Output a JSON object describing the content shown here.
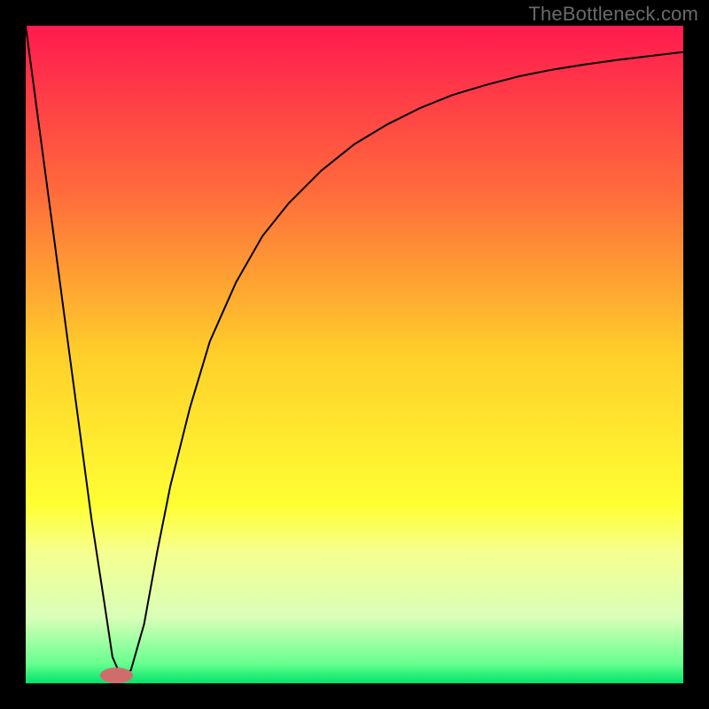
{
  "watermark": "TheBottleneck.com",
  "frame": {
    "outer_size": 800,
    "border_width": 29,
    "border_color": "#000000"
  },
  "chart_data": {
    "type": "line",
    "title": "",
    "xlabel": "",
    "ylabel": "",
    "xlim": [
      0,
      100
    ],
    "ylim": [
      0,
      100
    ],
    "gradient_stops": [
      {
        "offset": 0.0,
        "color": "#ff1a4f"
      },
      {
        "offset": 0.25,
        "color": "#ff6a3c"
      },
      {
        "offset": 0.5,
        "color": "#ffcf2a"
      },
      {
        "offset": 0.73,
        "color": "#ffff33"
      },
      {
        "offset": 0.8,
        "color": "#f6ff8f"
      },
      {
        "offset": 0.9,
        "color": "#d8ffb8"
      },
      {
        "offset": 0.97,
        "color": "#69ff8f"
      },
      {
        "offset": 1.0,
        "color": "#00e36a"
      }
    ],
    "series": [
      {
        "name": "bottleneck-curve",
        "x": [
          0,
          2,
          4,
          6,
          8,
          10,
          12,
          13.2,
          14.5,
          16,
          18,
          20,
          22,
          25,
          28,
          32,
          36,
          40,
          45,
          50,
          55,
          60,
          65,
          70,
          75,
          80,
          85,
          90,
          95,
          100
        ],
        "y": [
          100,
          85,
          70,
          55,
          40,
          25,
          12,
          4,
          1,
          2,
          9,
          20,
          30,
          42,
          52,
          61,
          68,
          73,
          78,
          82,
          85,
          87.5,
          89.5,
          91,
          92.3,
          93.3,
          94.1,
          94.8,
          95.4,
          96
        ]
      }
    ],
    "marker": {
      "name": "optimal-point",
      "x": 13.8,
      "y": 1.2,
      "rx": 2.5,
      "ry": 1.2,
      "fill": "#cf6d6d"
    }
  }
}
